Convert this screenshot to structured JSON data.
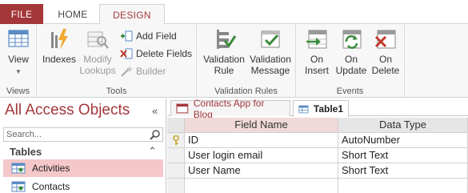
{
  "ribbon_tabs": {
    "file": "FILE",
    "home": "HOME",
    "design": "DESIGN"
  },
  "groups": {
    "views": {
      "label": "Views",
      "view_button": "View"
    },
    "tools": {
      "label": "Tools",
      "indexes": "Indexes",
      "modify_lookups_line1": "Modify",
      "modify_lookups_line2": "Lookups",
      "add_field": "Add Field",
      "delete_fields": "Delete Fields",
      "builder": "Builder"
    },
    "validation": {
      "label": "Validation Rules",
      "rule_line1": "Validation",
      "rule_line2": "Rule",
      "message_line1": "Validation",
      "message_line2": "Message"
    },
    "events": {
      "label": "Events",
      "insert_line1": "On",
      "insert_line2": "Insert",
      "update_line1": "On",
      "update_line2": "Update",
      "delete_line1": "On",
      "delete_line2": "Delete"
    }
  },
  "nav": {
    "title": "All Access Objects",
    "collapse_glyph": "«",
    "search_placeholder": "Search...",
    "section": "Tables",
    "section_glyph": "⌃",
    "items": [
      "Activities",
      "Contacts"
    ]
  },
  "doc_tabs": [
    "Contacts App for Blog",
    "Table1"
  ],
  "grid": {
    "headers": {
      "field_name": "Field Name",
      "data_type": "Data Type"
    },
    "rows": [
      {
        "name": "ID",
        "type": "AutoNumber",
        "is_key": true
      },
      {
        "name": "User login email",
        "type": "Short Text",
        "is_key": false
      },
      {
        "name": "User Name",
        "type": "Short Text",
        "is_key": false
      },
      {
        "name": "",
        "type": "",
        "is_key": false
      }
    ]
  },
  "colors": {
    "accent": "#a4373a",
    "selected_nav": "#f4c7c8",
    "header_highlight": "#f0d9d9"
  }
}
